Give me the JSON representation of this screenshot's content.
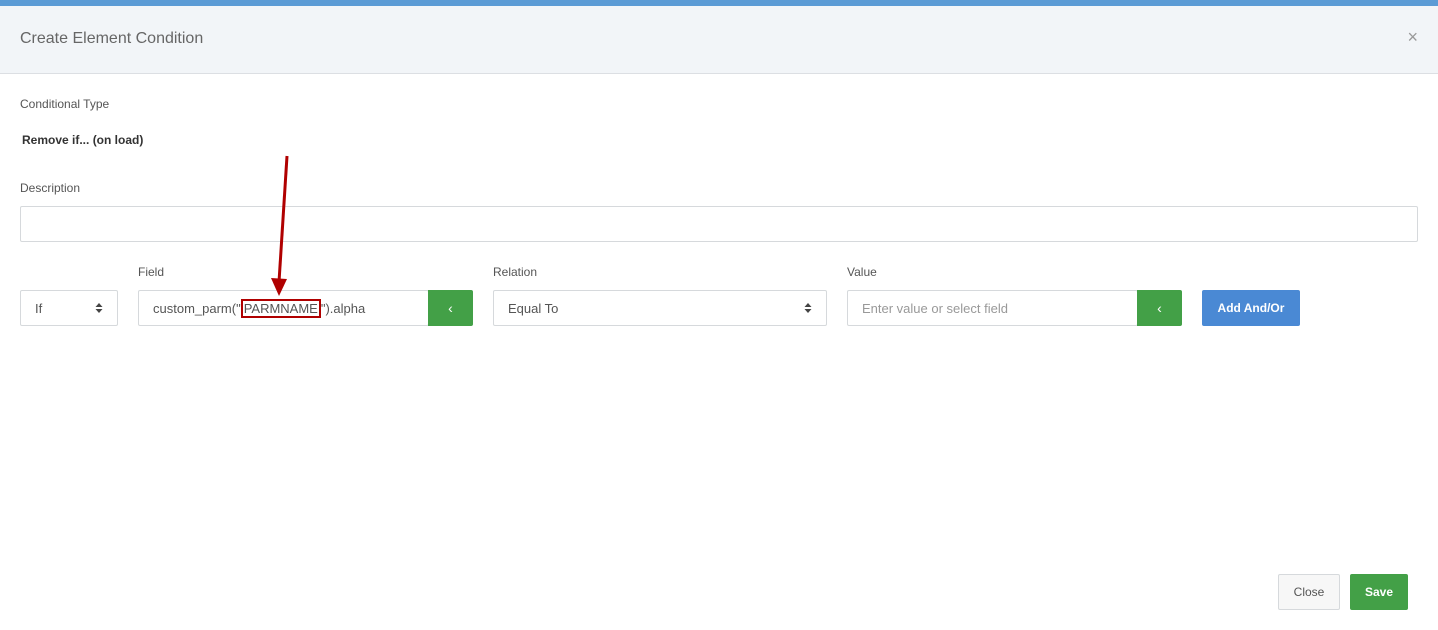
{
  "modal": {
    "title": "Create Element Condition",
    "close_icon": "×"
  },
  "conditional_type": {
    "label": "Conditional Type",
    "value": "Remove if... (on load)"
  },
  "description": {
    "label": "Description",
    "value": ""
  },
  "condition_row": {
    "operator": {
      "selected": "If"
    },
    "field": {
      "label": "Field",
      "value_prefix": "custom_parm(\"",
      "value_param": "PARMNAME",
      "value_suffix": "\").alpha",
      "button_icon": "‹"
    },
    "relation": {
      "label": "Relation",
      "selected": "Equal To"
    },
    "value": {
      "label": "Value",
      "placeholder": "Enter value or select field",
      "button_icon": "‹"
    },
    "add_button": "Add And/Or"
  },
  "footer": {
    "close_label": "Close",
    "save_label": "Save"
  },
  "colors": {
    "accent": "#5b9bd5",
    "green": "#43a047",
    "blue": "#4a89d4",
    "annotation": "#b00000"
  }
}
